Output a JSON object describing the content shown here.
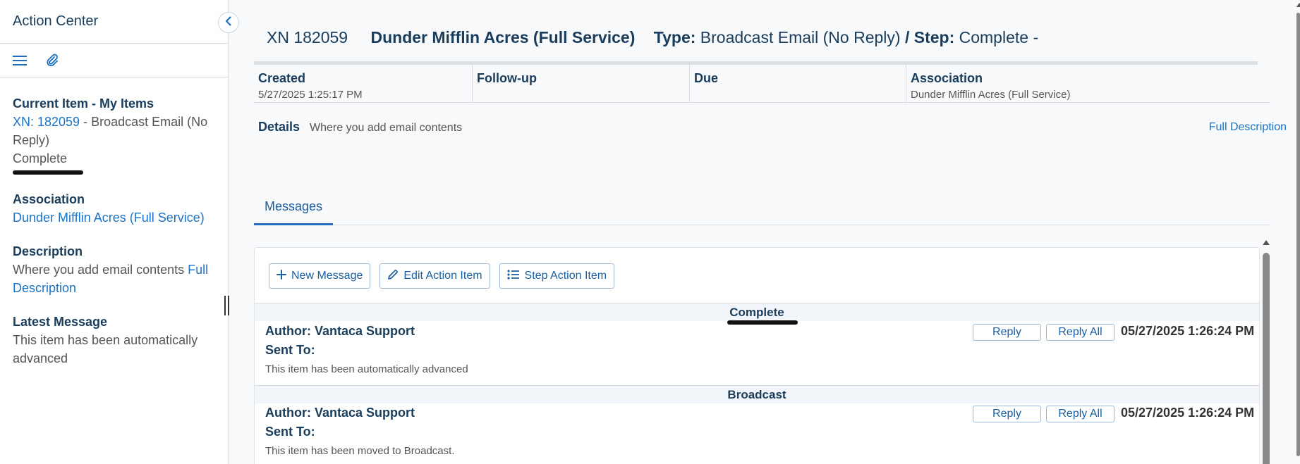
{
  "sidebar": {
    "title": "Action Center",
    "current_item_label": "Current Item - My Items",
    "item_link": "XN: 182059",
    "item_type": " - Broadcast Email (No Reply)",
    "item_status": "Complete",
    "association_label": "Association",
    "association_value": "Dunder Mifflin Acres (Full Service)",
    "description_label": "Description",
    "description_text": "Where you add email contents",
    "description_link": "Full Description",
    "latest_message_label": "Latest Message",
    "latest_message_text": "This item has been automatically advanced"
  },
  "header": {
    "number": "XN 182059",
    "name": "Dunder Mifflin Acres (Full Service)",
    "type_label": "Type:",
    "type_value": "Broadcast Email (No Reply)",
    "step_label": "/ Step:",
    "step_value": "Complete -"
  },
  "info": {
    "created_label": "Created",
    "created_value": "5/27/2025 1:25:17 PM",
    "followup_label": "Follow-up",
    "due_label": "Due",
    "association_label": "Association",
    "association_value": "Dunder Mifflin Acres (Full Service)",
    "details_label": "Details",
    "details_value": "Where you add email contents",
    "full_description": "Full Description"
  },
  "tabs": {
    "messages": "Messages"
  },
  "toolbar": {
    "new_message": "New Message",
    "edit_action_item": "Edit Action Item",
    "step_action_item": "Step Action Item"
  },
  "messages": [
    {
      "step": "Complete",
      "author": "Author: Vantaca Support",
      "sent_to": "Sent To:",
      "body": "This item has been automatically advanced",
      "reply": "Reply",
      "reply_all": "Reply All",
      "date": "05/27/2025 1:26:24 PM"
    },
    {
      "step": "Broadcast",
      "author": "Author: Vantaca Support",
      "sent_to": "Sent To:",
      "body": "This item has been moved to Broadcast.",
      "reply": "Reply",
      "reply_all": "Reply All",
      "date": "05/27/2025 1:26:24 PM"
    }
  ],
  "colors": {
    "heading": "#1a3d5c",
    "link": "#1a73c4",
    "border": "#d9dde2"
  }
}
